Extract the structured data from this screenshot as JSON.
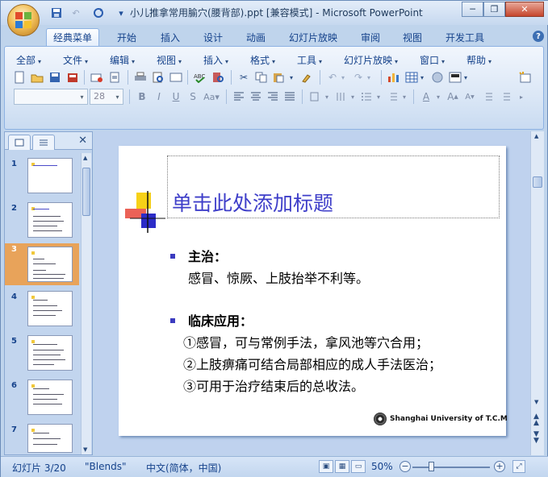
{
  "window": {
    "title": "小儿推拿常用腧穴(腰背部).ppt [兼容模式] - Microsoft PowerPoint",
    "minimize": "─",
    "restore": "❐",
    "close": "✕"
  },
  "qat": {
    "save_icon": "save-icon",
    "undo_icon": "undo-icon",
    "redo_icon": "redo-icon",
    "customize": "▾"
  },
  "tabs": [
    "经典菜单",
    "开始",
    "插入",
    "设计",
    "动画",
    "幻灯片放映",
    "审阅",
    "视图",
    "开发工具"
  ],
  "active_tab": "经典菜单",
  "help": "?",
  "classic_menu": [
    "全部",
    "文件",
    "编辑",
    "视图",
    "插入",
    "格式",
    "工具",
    "幻灯片放映",
    "窗口",
    "帮助"
  ],
  "format": {
    "font_name": "",
    "font_size": "28"
  },
  "panel_tabs": {
    "slides": "slides-tab",
    "outline": "outline-tab",
    "close": "✕"
  },
  "thumbnails": [
    {
      "num": "1",
      "selected": false
    },
    {
      "num": "2",
      "selected": false
    },
    {
      "num": "3",
      "selected": true
    },
    {
      "num": "4",
      "selected": false
    },
    {
      "num": "5",
      "selected": false
    },
    {
      "num": "6",
      "selected": false
    },
    {
      "num": "7",
      "selected": false
    }
  ],
  "slide": {
    "title_placeholder": "单击此处添加标题",
    "b1_title": "主治：",
    "b1_body": "感冒、惊厥、上肢抬举不利等。",
    "b2_title": "临床应用：",
    "b2_line1": "①感冒，可与常例手法，拿风池等穴合用；",
    "b2_line2": "②上肢痹痛可结合局部相应的成人手法医治；",
    "b2_line3": "③可用于治疗结束后的总收法。",
    "footer": "Shanghai University of T.C.M"
  },
  "status": {
    "slide_info": "幻灯片 3/20",
    "theme": "\"Blends\"",
    "language": "中文(简体，中国)",
    "zoom": "50%",
    "zoom_level_percent": 50
  },
  "colors": {
    "title": "#3e3ec9",
    "bullet": "#3b3bbf",
    "selected_thumb": "#e8a35a"
  }
}
